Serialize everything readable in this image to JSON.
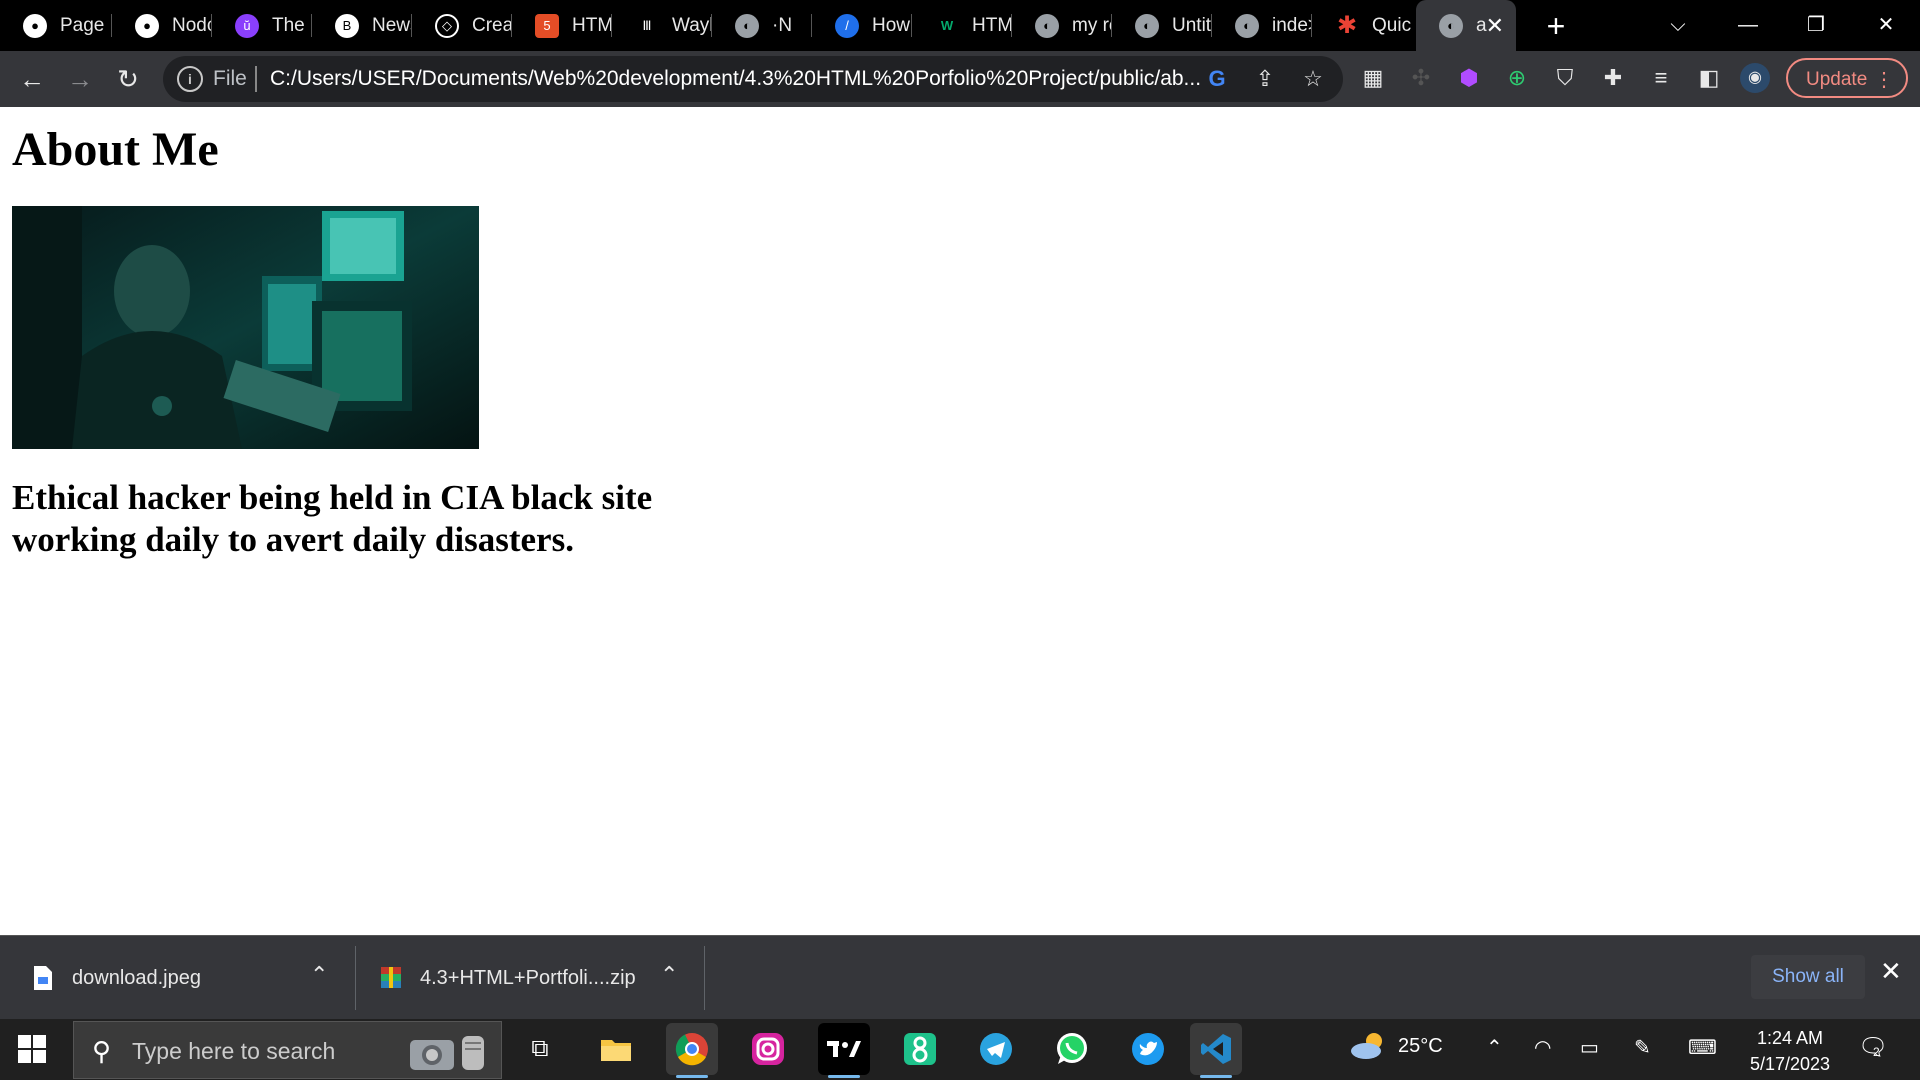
{
  "browser": {
    "tabs": [
      {
        "label": "Page",
        "icon": "github-icon"
      },
      {
        "label": "Nodc",
        "icon": "github-icon"
      },
      {
        "label": "The (",
        "icon": "udemy-icon"
      },
      {
        "label": "News",
        "icon": "news-icon"
      },
      {
        "label": "Creat",
        "icon": "codepen-icon"
      },
      {
        "label": "HTMl",
        "icon": "html5-icon"
      },
      {
        "label": "Wayl",
        "icon": "archive-icon"
      },
      {
        "label": "·N",
        "icon": "globe-icon"
      },
      {
        "label": "How",
        "icon": "freecodecamp-icon"
      },
      {
        "label": "HTMl",
        "icon": "w3schools-icon"
      },
      {
        "label": "my re",
        "icon": "globe-icon"
      },
      {
        "label": "Untit",
        "icon": "globe-icon"
      },
      {
        "label": "inde>",
        "icon": "globe-icon"
      },
      {
        "label": "Quic",
        "icon": "asterisk-icon"
      },
      {
        "label": "a",
        "icon": "globe-icon",
        "active": true
      }
    ],
    "address": {
      "scheme_label": "File",
      "url": "C:/Users/USER/Documents/Web%20development/4.3%20HTML%20Porfolio%20Project/public/ab..."
    },
    "update_label": "Update"
  },
  "page": {
    "heading": "About Me",
    "caption": "Ethical hacker being held in CIA black site working daily to avert daily disasters."
  },
  "downloads": {
    "items": [
      {
        "name": "download.jpeg",
        "icon": "file-icon"
      },
      {
        "name": "4.3+HTML+Portfoli....zip",
        "icon": "winrar-icon"
      }
    ],
    "show_all_label": "Show all"
  },
  "taskbar": {
    "search_placeholder": "Type here to search",
    "apps": [
      "task-view",
      "file-explorer",
      "chrome",
      "instagram",
      "tradingview",
      "8-app",
      "telegram",
      "whatsapp",
      "twitter",
      "vscode"
    ],
    "weather": "25°C",
    "time": "1:24 AM",
    "date": "5/17/2023",
    "notification_count": "2"
  },
  "colors": {
    "tabstrip": "#000000",
    "toolbar": "#35363a",
    "omnibox": "#202124",
    "update_accent": "#f28b82",
    "taskbar": "#202020",
    "link_blue": "#8ab4f8"
  }
}
